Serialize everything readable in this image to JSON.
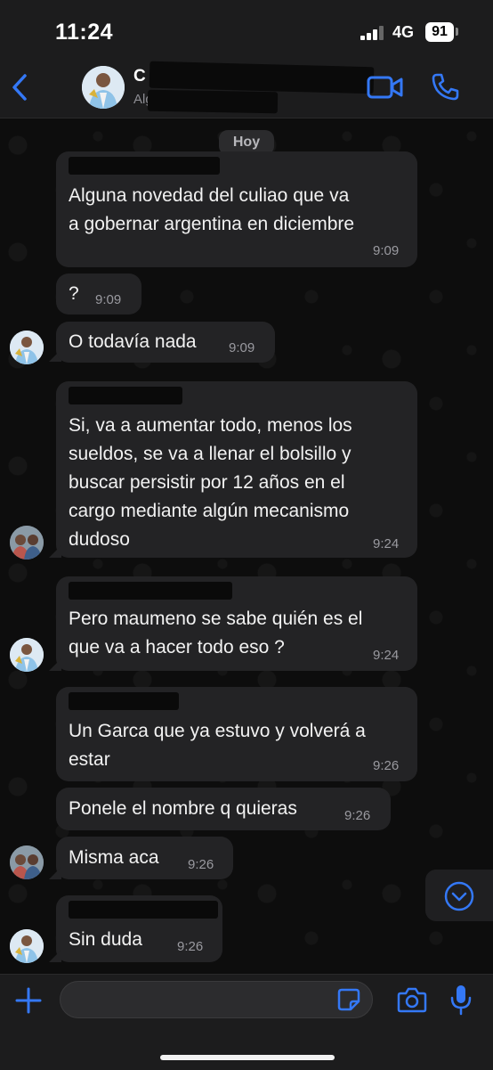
{
  "status": {
    "time": "11:24",
    "network": "4G",
    "battery": "91"
  },
  "header": {
    "contact_name": "C",
    "contact_subtitle": "Alg                            os,..."
  },
  "chat": {
    "day_label": "Hoy",
    "messages": [
      {
        "text": "Alguna novedad del culiao que va\na gobernar argentina en diciembre",
        "time": "9:09"
      },
      {
        "text": "?",
        "time": "9:09"
      },
      {
        "text": "O todavía nada",
        "time": "9:09"
      },
      {
        "text": "Si, va a aumentar todo, menos los\nsueldos, se va a llenar el bolsillo y\nbuscar persistir por 12 años en el\ncargo mediante algún mecanismo\ndudoso",
        "time": "9:24"
      },
      {
        "text": "Pero maumeno se sabe quién es el\nque va a hacer todo eso ?",
        "time": "9:24"
      },
      {
        "text": "Un Garca que ya estuvo y volverá a\nestar",
        "time": "9:26"
      },
      {
        "text": "Ponele el nombre q quieras",
        "time": "9:26"
      },
      {
        "text": "Misma aca",
        "time": "9:26"
      },
      {
        "text": "Sin duda",
        "time": "9:26"
      }
    ]
  },
  "composer": {
    "placeholder": ""
  },
  "colors": {
    "accent": "#3478f6",
    "bubble": "#232325",
    "background": "#0d0d0d",
    "bar": "#1c1c1d"
  },
  "icons": [
    "back-chevron-icon",
    "video-call-icon",
    "phone-icon",
    "chevron-down-icon",
    "plus-icon",
    "sticker-icon",
    "camera-icon",
    "microphone-icon"
  ]
}
